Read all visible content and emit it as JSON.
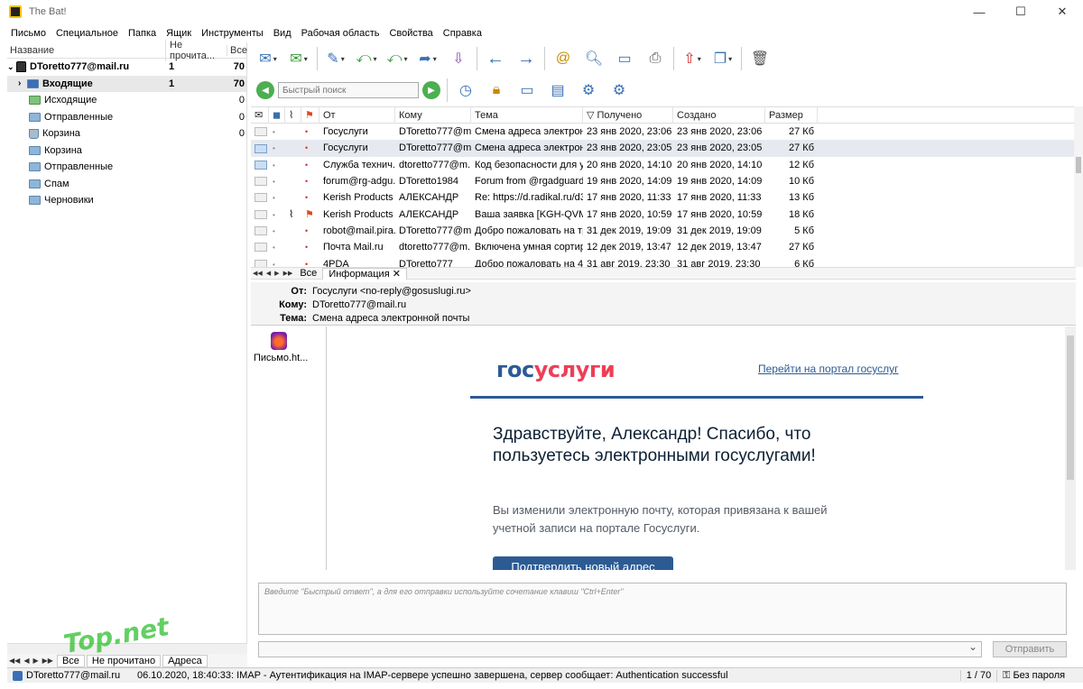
{
  "window": {
    "title": "The Bat!",
    "minimize": "—",
    "maximize": "☐",
    "close": "✕"
  },
  "menu": [
    "Письмо",
    "Специальное",
    "Папка",
    "Ящик",
    "Инструменты",
    "Вид",
    "Рабочая область",
    "Свойства",
    "Справка"
  ],
  "tree": {
    "headers": {
      "name": "Название",
      "unread": "Не прочита...",
      "total": "Все"
    },
    "account": {
      "name": "DToretto777@mail.ru",
      "unread": "1",
      "total": "70"
    },
    "folders": [
      {
        "name": "Входящие",
        "unread": "1",
        "total": "70",
        "icon": "inbox-folder-icon"
      },
      {
        "name": "Исходящие",
        "unread": "",
        "total": "0",
        "icon": "outbox-folder-icon"
      },
      {
        "name": "Отправленные",
        "unread": "",
        "total": "0",
        "icon": "sent-folder-icon"
      },
      {
        "name": "Корзина",
        "unread": "",
        "total": "0",
        "icon": "trash-folder-icon"
      },
      {
        "name": "Корзина",
        "unread": "",
        "total": "",
        "icon": "folder-icon"
      },
      {
        "name": "Отправленные",
        "unread": "",
        "total": "",
        "icon": "folder-icon"
      },
      {
        "name": "Спам",
        "unread": "",
        "total": "",
        "icon": "folder-icon"
      },
      {
        "name": "Черновики",
        "unread": "",
        "total": "",
        "icon": "folder-icon"
      }
    ]
  },
  "left_tabs": [
    "Все",
    "Не прочитано",
    "Адреса"
  ],
  "watermark": "Top.net",
  "quick_search": {
    "placeholder": "Быстрый поиск"
  },
  "list": {
    "headers": {
      "from": "От",
      "to": "Кому",
      "subject": "Тема",
      "received": "Получено",
      "created": "Создано",
      "size": "Размер"
    },
    "rows": [
      {
        "from": "Госуслуги",
        "to": "DToretto777@m...",
        "subject": "Смена адреса электронн...",
        "received": "23 янв 2020, 23:06",
        "created": "23 янв 2020, 23:06",
        "size": "27 Кб",
        "flag": "",
        "attach": ""
      },
      {
        "from": "Госуслуги",
        "to": "DToretto777@m...",
        "subject": "Смена адреса электронн...",
        "received": "23 янв 2020, 23:05",
        "created": "23 янв 2020, 23:05",
        "size": "27 Кб",
        "flag": "",
        "attach": ""
      },
      {
        "from": "Служба технич...",
        "to": "dtoretto777@m...",
        "subject": "Код безопасности для уч...",
        "received": "20 янв 2020, 14:10",
        "created": "20 янв 2020, 14:10",
        "size": "12 Кб",
        "flag": "",
        "attach": ""
      },
      {
        "from": "forum@rg-adgu...",
        "to": "DToretto1984",
        "subject": "Forum from @rgadguard ...",
        "received": "19 янв 2020, 14:09",
        "created": "19 янв 2020, 14:09",
        "size": "10 Кб",
        "flag": "",
        "attach": ""
      },
      {
        "from": "Kerish Products",
        "to": "АЛЕКСАНДР",
        "subject": "Re: https://d.radikal.ru/d3...",
        "received": "17 янв 2020, 11:33",
        "created": "17 янв 2020, 11:33",
        "size": "13 Кб",
        "flag": "",
        "attach": ""
      },
      {
        "from": "Kerish Products ...",
        "to": "АЛЕКСАНДР",
        "subject": "Ваша заявка [KGH-QVM...",
        "received": "17 янв 2020, 10:59",
        "created": "17 янв 2020, 10:59",
        "size": "18 Кб",
        "flag": "⚑",
        "attach": "⌇"
      },
      {
        "from": "robot@mail.pira...",
        "to": "DToretto777@m...",
        "subject": "Добро пожаловать на тр...",
        "received": "31 дек 2019, 19:09",
        "created": "31 дек 2019, 19:09",
        "size": "5 Кб",
        "flag": "",
        "attach": ""
      },
      {
        "from": "Почта Mail.ru",
        "to": "dtoretto777@m...",
        "subject": "Включена умная сортир...",
        "received": "12 дек 2019, 13:47",
        "created": "12 дек 2019, 13:47",
        "size": "27 Кб",
        "flag": "",
        "attach": ""
      },
      {
        "from": "4PDA",
        "to": "DToretto777",
        "subject": "Добро пожаловать на 4P...",
        "received": "31 авг 2019, 23:30",
        "created": "31 авг 2019, 23:30",
        "size": "6 Кб",
        "flag": "",
        "attach": ""
      }
    ]
  },
  "msg_tabs": [
    "Все",
    "Информация"
  ],
  "message": {
    "from_label": "От:",
    "from": "Госуслуги <no-reply@gosuslugi.ru>",
    "to_label": "Кому:",
    "to": "DToretto777@mail.ru",
    "subject_label": "Тема:",
    "subject": "Смена адреса электронной почты",
    "attachment": "Письмо.ht...",
    "logo_a": "гос",
    "logo_b": "услуги",
    "portal_link": "Перейти на портал госуслуг",
    "greeting": "Здравствуйте, Александр! Спасибо, что пользуетесь электронными госуслугами!",
    "info": "Вы изменили электронную почту, которая привязана к вашей учетной записи на портале Госуслуги.",
    "confirm_button": "Подтвердить новый адрес"
  },
  "reply": {
    "placeholder": "Введите \"Быстрый ответ\", а для его отправки используйте сочетание клавиш \"Ctrl+Enter\"",
    "send": "Отправить"
  },
  "status": {
    "account": "DToretto777@mail.ru",
    "message": "06.10.2020, 18:40:33: IMAP - Аутентификация на IMAP-сервере успешно завершена, сервер сообщает: Authentication successful",
    "count": "1 / 70",
    "password": "Без пароля"
  },
  "colors": {
    "accent": "#2c5b94",
    "logo_red": "#ee3f58",
    "flag": "#e24a1c"
  }
}
